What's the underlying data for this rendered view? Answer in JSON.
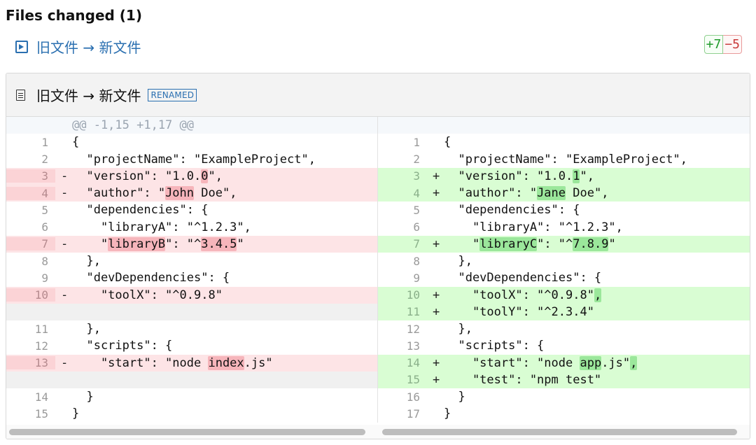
{
  "heading": "Files changed (1)",
  "file": {
    "link_label": "旧文件 → 新文件",
    "header_title": "旧文件 → 新文件",
    "badge": "RENAMED",
    "additions": "+7",
    "deletions": "−5"
  },
  "colors": {
    "link": "#2a6fb0",
    "added_bg": "#d9fdd3",
    "deleted_bg": "#fde4e6",
    "added_highlight": "#9be79b",
    "deleted_highlight": "#f6b5bb"
  },
  "icons": {
    "file_link": "arrow-into-box-icon",
    "file_header": "document-icon"
  },
  "hunk_header": "@@ -1,15 +1,17 @@",
  "left_rows": [
    {
      "t": "hunk",
      "ln": "",
      "sign": "",
      "code": [
        [
          "@@ -1,15 +1,17 @@",
          ""
        ]
      ]
    },
    {
      "t": "ctx",
      "ln": "1",
      "sign": "",
      "code": [
        [
          "{",
          ""
        ]
      ]
    },
    {
      "t": "ctx",
      "ln": "2",
      "sign": "",
      "code": [
        [
          "  \"projectName\": \"ExampleProject\",",
          ""
        ]
      ]
    },
    {
      "t": "del",
      "ln": "3",
      "sign": "-",
      "code": [
        [
          "  \"version\": \"1.0.",
          ""
        ],
        [
          "0",
          "h"
        ],
        [
          "\",",
          ""
        ]
      ]
    },
    {
      "t": "del",
      "ln": "4",
      "sign": "-",
      "code": [
        [
          "  \"author\": \"",
          ""
        ],
        [
          "John",
          "h"
        ],
        [
          " Doe\",",
          ""
        ]
      ]
    },
    {
      "t": "ctx",
      "ln": "5",
      "sign": "",
      "code": [
        [
          "  \"dependencies\": {",
          ""
        ]
      ]
    },
    {
      "t": "ctx",
      "ln": "6",
      "sign": "",
      "code": [
        [
          "    \"libraryA\": \"^1.2.3\",",
          ""
        ]
      ]
    },
    {
      "t": "del",
      "ln": "7",
      "sign": "-",
      "code": [
        [
          "    \"",
          ""
        ],
        [
          "libraryB",
          "h"
        ],
        [
          "\": \"^",
          ""
        ],
        [
          "3.4.5",
          "h"
        ],
        [
          "\"",
          ""
        ]
      ]
    },
    {
      "t": "ctx",
      "ln": "8",
      "sign": "",
      "code": [
        [
          "  },",
          ""
        ]
      ]
    },
    {
      "t": "ctx",
      "ln": "9",
      "sign": "",
      "code": [
        [
          "  \"devDependencies\": {",
          ""
        ]
      ]
    },
    {
      "t": "del",
      "ln": "10",
      "sign": "-",
      "code": [
        [
          "    \"toolX\": \"^0.9.8\"",
          ""
        ]
      ]
    },
    {
      "t": "empty",
      "ln": "",
      "sign": "",
      "code": [
        [
          "",
          ""
        ]
      ]
    },
    {
      "t": "ctx",
      "ln": "11",
      "sign": "",
      "code": [
        [
          "  },",
          ""
        ]
      ]
    },
    {
      "t": "ctx",
      "ln": "12",
      "sign": "",
      "code": [
        [
          "  \"scripts\": {",
          ""
        ]
      ]
    },
    {
      "t": "del",
      "ln": "13",
      "sign": "-",
      "code": [
        [
          "    \"start\": \"node ",
          ""
        ],
        [
          "index",
          "h"
        ],
        [
          ".js\"",
          ""
        ]
      ]
    },
    {
      "t": "empty",
      "ln": "",
      "sign": "",
      "code": [
        [
          "",
          ""
        ]
      ]
    },
    {
      "t": "ctx",
      "ln": "14",
      "sign": "",
      "code": [
        [
          "  }",
          ""
        ]
      ]
    },
    {
      "t": "ctx",
      "ln": "15",
      "sign": "",
      "code": [
        [
          "}",
          ""
        ]
      ]
    }
  ],
  "right_rows": [
    {
      "t": "hunk",
      "ln": "",
      "sign": "",
      "code": [
        [
          "",
          ""
        ]
      ]
    },
    {
      "t": "ctx",
      "ln": "1",
      "sign": "",
      "code": [
        [
          "{",
          ""
        ]
      ]
    },
    {
      "t": "ctx",
      "ln": "2",
      "sign": "",
      "code": [
        [
          "  \"projectName\": \"ExampleProject\",",
          ""
        ]
      ]
    },
    {
      "t": "add",
      "ln": "3",
      "sign": "+",
      "code": [
        [
          "  \"version\": \"1.0.",
          ""
        ],
        [
          "1",
          "h"
        ],
        [
          "\",",
          ""
        ]
      ]
    },
    {
      "t": "add",
      "ln": "4",
      "sign": "+",
      "code": [
        [
          "  \"author\": \"",
          ""
        ],
        [
          "Jane",
          "h"
        ],
        [
          " Doe\",",
          ""
        ]
      ]
    },
    {
      "t": "ctx",
      "ln": "5",
      "sign": "",
      "code": [
        [
          "  \"dependencies\": {",
          ""
        ]
      ]
    },
    {
      "t": "ctx",
      "ln": "6",
      "sign": "",
      "code": [
        [
          "    \"libraryA\": \"^1.2.3\",",
          ""
        ]
      ]
    },
    {
      "t": "add",
      "ln": "7",
      "sign": "+",
      "code": [
        [
          "    \"",
          ""
        ],
        [
          "libraryC",
          "h"
        ],
        [
          "\": \"^",
          ""
        ],
        [
          "7.8.9",
          "h"
        ],
        [
          "\"",
          ""
        ]
      ]
    },
    {
      "t": "ctx",
      "ln": "8",
      "sign": "",
      "code": [
        [
          "  },",
          ""
        ]
      ]
    },
    {
      "t": "ctx",
      "ln": "9",
      "sign": "",
      "code": [
        [
          "  \"devDependencies\": {",
          ""
        ]
      ]
    },
    {
      "t": "add",
      "ln": "10",
      "sign": "+",
      "code": [
        [
          "    \"toolX\": \"^0.9.8\"",
          ""
        ],
        [
          ",",
          "h"
        ]
      ]
    },
    {
      "t": "add",
      "ln": "11",
      "sign": "+",
      "code": [
        [
          "    \"toolY\": \"^2.3.4\"",
          ""
        ]
      ]
    },
    {
      "t": "ctx",
      "ln": "12",
      "sign": "",
      "code": [
        [
          "  },",
          ""
        ]
      ]
    },
    {
      "t": "ctx",
      "ln": "13",
      "sign": "",
      "code": [
        [
          "  \"scripts\": {",
          ""
        ]
      ]
    },
    {
      "t": "add",
      "ln": "14",
      "sign": "+",
      "code": [
        [
          "    \"start\": \"node ",
          ""
        ],
        [
          "app",
          "h"
        ],
        [
          ".js\"",
          ""
        ],
        [
          ",",
          "h"
        ]
      ]
    },
    {
      "t": "add",
      "ln": "15",
      "sign": "+",
      "code": [
        [
          "    \"test\": \"npm test\"",
          ""
        ]
      ]
    },
    {
      "t": "ctx",
      "ln": "16",
      "sign": "",
      "code": [
        [
          "  }",
          ""
        ]
      ]
    },
    {
      "t": "ctx",
      "ln": "17",
      "sign": "",
      "code": [
        [
          "}",
          ""
        ]
      ]
    }
  ]
}
